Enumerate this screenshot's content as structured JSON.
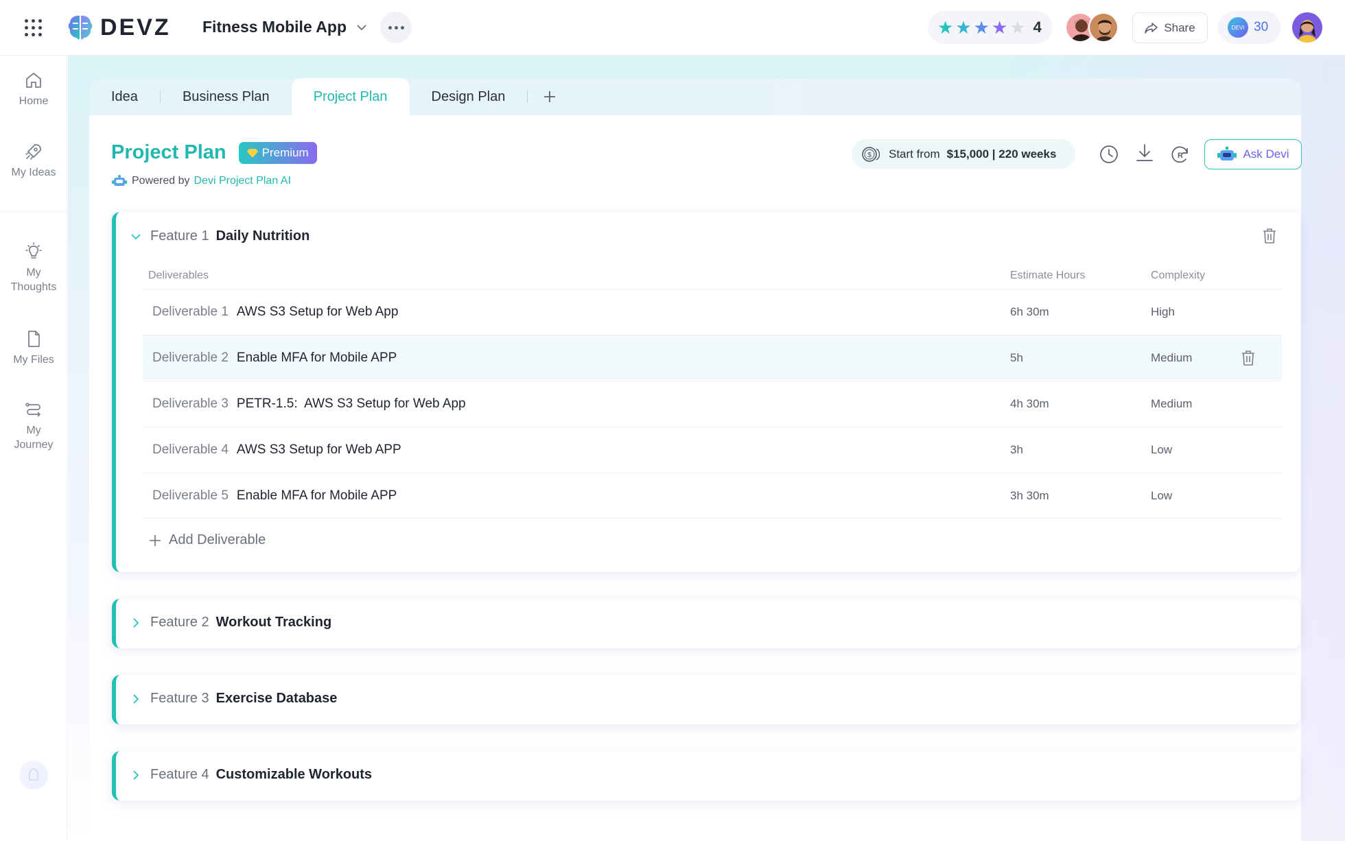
{
  "brand": {
    "name": "DEVZ"
  },
  "header": {
    "project_title": "Fitness Mobile App",
    "rating": {
      "value": "4",
      "stars_filled": 4,
      "stars_total": 5
    },
    "share_label": "Share",
    "credits": {
      "coin_label": "DEVI",
      "count": "30"
    }
  },
  "sidebar": {
    "items": [
      {
        "label": "Home",
        "icon": "home-icon"
      },
      {
        "label": "My Ideas",
        "icon": "rocket-icon"
      },
      {
        "label": "My Thoughts",
        "icon": "bulb-icon"
      },
      {
        "label": "My Files",
        "icon": "file-icon"
      },
      {
        "label": "My Journey",
        "icon": "route-icon"
      }
    ]
  },
  "tabs": [
    {
      "label": "Idea"
    },
    {
      "label": "Business Plan"
    },
    {
      "label": "Project Plan",
      "active": true
    },
    {
      "label": "Design Plan"
    }
  ],
  "page": {
    "title": "Project Plan",
    "badge": "Premium",
    "powered_prefix": "Powered by",
    "powered_link": "Devi Project Plan AI",
    "estimate_prefix": "Start from",
    "estimate_value": "$15,000 | 220 weeks",
    "ask_label": "Ask Devi"
  },
  "features": [
    {
      "no": "Feature 1",
      "name": "Daily Nutrition",
      "expanded": true,
      "columns": {
        "deliverables": "Deliverables",
        "hours": "Estimate Hours",
        "complexity": "Complexity"
      },
      "deliverables": [
        {
          "no": "Deliverable 1",
          "name": "AWS S3 Setup for Web App",
          "hours": "6h 30m",
          "complexity": "High"
        },
        {
          "no": "Deliverable 2",
          "name": "Enable MFA for Mobile APP",
          "hours": "5h",
          "complexity": "Medium"
        },
        {
          "no": "Deliverable 3",
          "name": "PETR-1.5:  AWS S3 Setup for Web App",
          "hours": "4h 30m",
          "complexity": "Medium"
        },
        {
          "no": "Deliverable 4",
          "name": "AWS S3 Setup for Web APP",
          "hours": "3h",
          "complexity": "Low"
        },
        {
          "no": "Deliverable 5",
          "name": "Enable MFA for Mobile APP",
          "hours": "3h 30m",
          "complexity": "Low"
        }
      ],
      "add_label": "Add Deliverable"
    },
    {
      "no": "Feature 2",
      "name": "Workout Tracking",
      "expanded": false
    },
    {
      "no": "Feature 3",
      "name": "Exercise Database",
      "expanded": false
    },
    {
      "no": "Feature 4",
      "name": "Customizable Workouts",
      "expanded": false
    }
  ],
  "colors": {
    "accent": "#22b8b0",
    "purple": "#6b5ff0",
    "border": "#26bfb5"
  }
}
